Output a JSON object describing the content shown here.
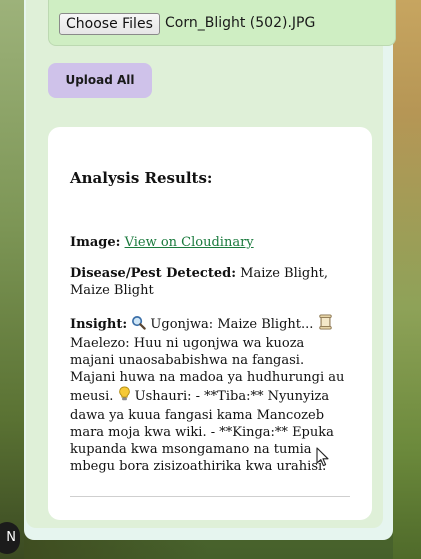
{
  "upload": {
    "choose_label": "Choose Files",
    "file_name": "Corn_Blight (502).JPG",
    "upload_all_label": "Upload All"
  },
  "results": {
    "title": "Analysis Results:",
    "image_label": "Image:",
    "image_link": "View on Cloudinary",
    "disease_label": "Disease/Pest Detected:",
    "disease_value": "Maize Blight, Maize Blight",
    "insight_label": "Insight:",
    "insight_part1": "Ugonjwa: Maize Blight...",
    "insight_part2": "Maelezo: Huu ni ugonjwa wa kuoza majani unaosababishwa na fangasi. Majani huwa na madoa ya hudhurungi au meusi.",
    "insight_part3": "Ushauri: - **Tiba:** Nyunyiza dawa ya kuua fangasi kama Mancozeb mara moja kwa wiki. - **Kinga:** Epuka kupanda kwa msongamano na tumia mbegu bora zisizoathirika kwa urahisi."
  },
  "corner_badge": "N",
  "icons": {
    "magnifier": "magnifying-glass-icon",
    "scroll": "scroll-icon",
    "bulb": "light-bulb-icon"
  }
}
